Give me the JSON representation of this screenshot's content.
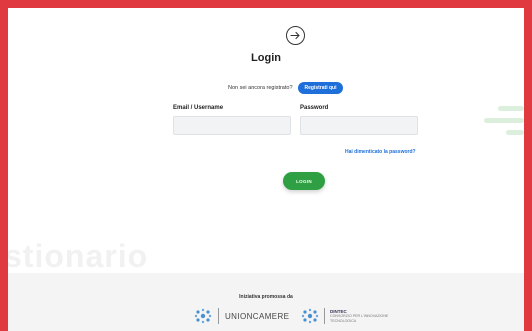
{
  "header": {
    "title": "Login"
  },
  "register": {
    "question": "Non sei ancora registrato?",
    "button_label": "Registrati qui"
  },
  "form": {
    "email_label": "Email / Username",
    "email_value": "",
    "password_label": "Password",
    "password_value": "",
    "forgot_link": "Hai dimenticato la password?",
    "submit_label": "LOGIN"
  },
  "background_text": "stionario",
  "footer": {
    "promoted_by": "Iniziativa promossa da",
    "logo1_name": "UNIONCAMERE",
    "logo2_name": "DINTEC",
    "logo2_subtitle_line1": "CONSORZIO PER L'INNOVAZIONE",
    "logo2_subtitle_line2": "TECNOLOGICA"
  },
  "colors": {
    "frame": "#e0393f",
    "primary_blue": "#1e6fd9",
    "login_green": "#2ea043",
    "deco_green": "#dcefdc",
    "logo_blue": "#4a8fd0"
  },
  "icons": {
    "login": "login-arrow-icon",
    "logo1": "unioncamere-logo-icon",
    "logo2": "dintec-logo-icon"
  }
}
